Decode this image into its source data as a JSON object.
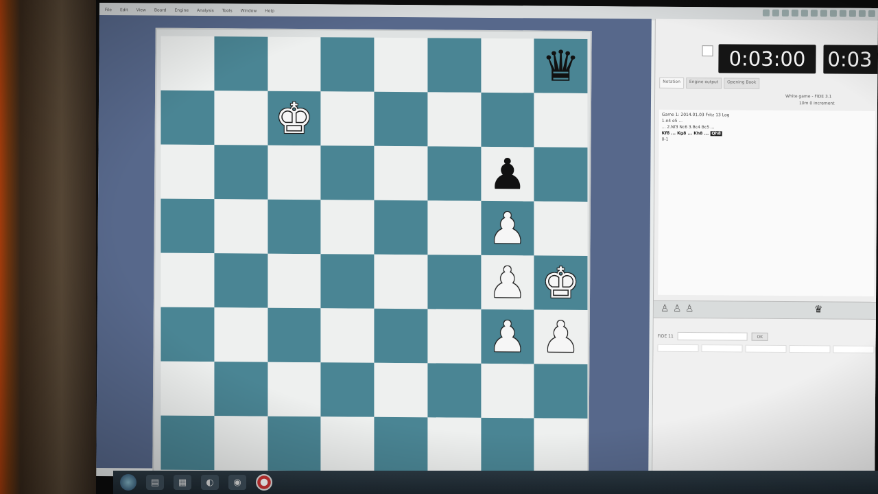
{
  "menu": {
    "items": [
      "File",
      "Edit",
      "View",
      "Board",
      "Engine",
      "Analysis",
      "Tools",
      "Window",
      "Help"
    ]
  },
  "board": {
    "rows": [
      [
        null,
        null,
        null,
        null,
        null,
        null,
        null,
        {
          "glyph": "♛",
          "color": "black",
          "name": "black-queen"
        }
      ],
      [
        null,
        null,
        {
          "glyph": "♚",
          "color": "white",
          "name": "white-king-outline"
        },
        null,
        null,
        null,
        null,
        null
      ],
      [
        null,
        null,
        null,
        null,
        null,
        null,
        {
          "glyph": "♟",
          "color": "black",
          "name": "black-pawn"
        },
        null
      ],
      [
        null,
        null,
        null,
        null,
        null,
        null,
        {
          "glyph": "♟",
          "color": "white",
          "name": "white-pawn"
        },
        null
      ],
      [
        null,
        null,
        null,
        null,
        null,
        null,
        {
          "glyph": "♟",
          "color": "white",
          "name": "white-pawn"
        },
        {
          "glyph": "♚",
          "color": "white",
          "name": "white-king"
        }
      ],
      [
        null,
        null,
        null,
        null,
        null,
        null,
        {
          "glyph": "♟",
          "color": "white",
          "name": "white-pawn"
        },
        {
          "glyph": "♟",
          "color": "white",
          "name": "white-pawn"
        }
      ],
      [
        null,
        null,
        null,
        null,
        null,
        null,
        null,
        null
      ],
      [
        null,
        null,
        null,
        null,
        null,
        null,
        null,
        null
      ]
    ],
    "light_color": "#eef0ef",
    "dark_color": "#4a8594"
  },
  "clocks": {
    "left": "0:03:00",
    "right": "0:03"
  },
  "tabs": [
    "Notation",
    "Engine output",
    "Opening Book"
  ],
  "notation": {
    "status": "White game - FIDE 3.1",
    "info": "10m 0 increment",
    "header_line": "Game 1: 2014.01.03 Fritz 13 Log",
    "line1": "1.e4 e5 ...",
    "line2": "... 2.Nf3 Nc6 3.Bc4 Bc5 ...",
    "line3": "Kf8 ... Kg8 ... Kh8 ...",
    "last_move": "Qh8",
    "result": "0-1"
  },
  "lower": {
    "label": "FIDE 11",
    "button": "OK"
  }
}
